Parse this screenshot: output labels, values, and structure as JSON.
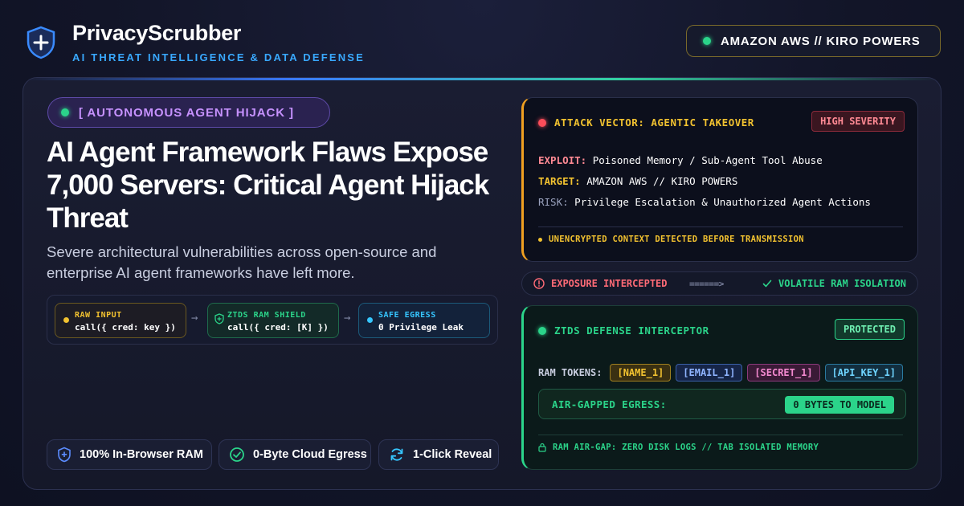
{
  "brand": {
    "name": "PrivacyScrubber",
    "tagline": "AI THREAT INTELLIGENCE & DATA DEFENSE"
  },
  "top_pill": {
    "label": "AMAZON AWS // KIRO POWERS"
  },
  "article": {
    "badge": "[ AUTONOMOUS AGENT HIJACK ]",
    "headline": "AI Agent Framework Flaws Expose 7,000 Servers: Critical Agent Hijack Threat",
    "subtext": "Severe architectural vulnerabilities across open-source and enterprise AI agent frameworks have left more."
  },
  "flow": {
    "raw": {
      "label": "RAW INPUT",
      "value": "call({ cred: key })"
    },
    "shield": {
      "label": "ZTDS RAM SHIELD",
      "value": "call({ cred: [K] })"
    },
    "egress": {
      "label": "SAFE EGRESS",
      "value": "0 Privilege Leak"
    },
    "arrow": "→"
  },
  "features": [
    {
      "label": "100% In-Browser RAM",
      "icon": "shield-icon"
    },
    {
      "label": "0-Byte Cloud Egress",
      "icon": "check-circle-icon"
    },
    {
      "label": "1-Click Reveal",
      "icon": "refresh-icon"
    }
  ],
  "attack": {
    "title": "ATTACK VECTOR: AGENTIC TAKEOVER",
    "severity": "HIGH SEVERITY",
    "rows": [
      {
        "key": "EXPLOIT:",
        "value": "Poisoned Memory / Sub-Agent Tool Abuse",
        "color": "#ff8a94"
      },
      {
        "key": "TARGET:",
        "value": "AMAZON AWS // KIRO POWERS",
        "color": "#f2c230"
      },
      {
        "key": "RISK:",
        "value": "Privilege Escalation & Unauthorized Agent Actions",
        "color": "#9aa2bd"
      }
    ],
    "footer": "UNENCRYPTED CONTEXT DETECTED BEFORE TRANSMISSION"
  },
  "intercept": {
    "left": "EXPOSURE INTERCEPTED",
    "arrow": "======>",
    "right": "VOLATILE RAM ISOLATION"
  },
  "defense": {
    "title": "ZTDS DEFENSE INTERCEPTOR",
    "status": "PROTECTED",
    "tokens_label": "RAM TOKENS:",
    "tokens": [
      "[NAME_1]",
      "[EMAIL_1]",
      "[SECRET_1]",
      "[API_KEY_1]"
    ],
    "egress_label": "AIR-GAPPED EGRESS:",
    "egress_value": "0 BYTES TO MODEL",
    "footer": "RAM AIR-GAP: ZERO DISK LOGS // TAB ISOLATED MEMORY"
  },
  "colors": {
    "accent_blue": "#39a9ff",
    "accent_green": "#2bd48a",
    "accent_yellow": "#f2c230",
    "accent_red": "#ff4d5a",
    "accent_purple": "#c792ff"
  }
}
